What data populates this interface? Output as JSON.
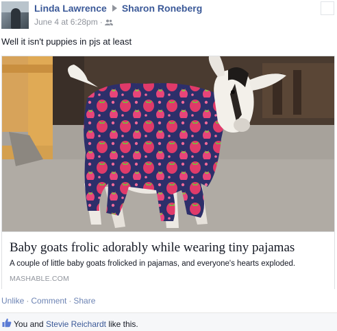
{
  "post": {
    "author": "Linda Lawrence",
    "recipient": "Sharon Roneberg",
    "timestamp": "June 4 at 6:28pm",
    "privacy_icon": "friends-icon",
    "message": "Well it isn't puppies in pjs at least"
  },
  "attachment": {
    "image_icon": "goat-in-pajamas-photo",
    "title": "Baby goats frolic adorably while wearing tiny pajamas",
    "description": "A couple of little baby goats frolicked in pajamas, and everyone's hearts exploded.",
    "source": "MASHABLE.COM"
  },
  "actions": {
    "unlike": "Unlike",
    "comment": "Comment",
    "share": "Share",
    "separator": "·"
  },
  "likes": {
    "prefix": "You and",
    "person": "Stevie Reichardt",
    "suffix": "like this.",
    "icon": "thumbs-up-icon"
  },
  "colors": {
    "link": "#3b5998",
    "action_link": "#6d84b4",
    "meta": "#90949c",
    "likes_bg": "#f6f7f9"
  }
}
